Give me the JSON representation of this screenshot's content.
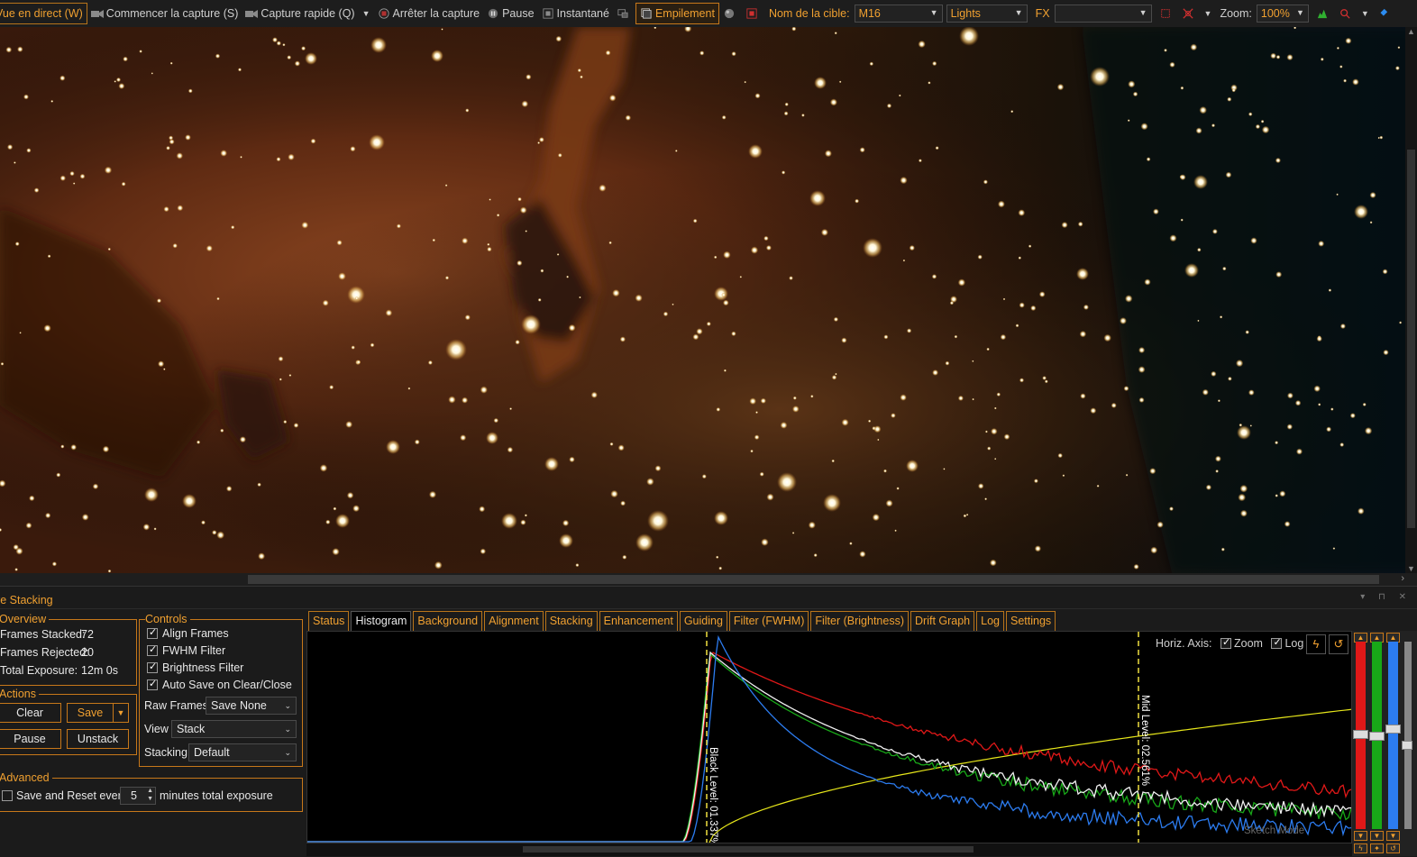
{
  "toolbar": {
    "live_view": "Vue en direct (W)",
    "start_capture": "Commencer la capture (S)",
    "quick_capture": "Capture rapide (Q)",
    "stop_capture": "Arrêter la capture",
    "pause": "Pause",
    "snapshot": "Instantané",
    "stacking": "Empilement",
    "target_label": "Nom de la cible:",
    "target_value": "M16",
    "frame_type": "Lights",
    "fx_label": "FX",
    "fx_value": "",
    "zoom_label": "Zoom:",
    "zoom_value": "100%"
  },
  "panel": {
    "title": "ve Stacking",
    "overview": {
      "title": "Overview",
      "frames_stacked_label": "Frames Stacked:",
      "frames_stacked_value": "72",
      "frames_rejected_label": "Frames Rejected:",
      "frames_rejected_value": "20",
      "total_exposure_label": "Total Exposure:",
      "total_exposure_value": "12m 0s"
    },
    "controls": {
      "title": "Controls",
      "align_frames": "Align Frames",
      "fwhm_filter": "FWHM Filter",
      "brightness_filter": "Brightness Filter",
      "auto_save": "Auto Save on Clear/Close",
      "raw_frames_label": "Raw Frames",
      "raw_frames_value": "Save None",
      "view_label": "View",
      "view_value": "Stack",
      "stacking_label": "Stacking",
      "stacking_value": "Default"
    },
    "actions": {
      "title": "Actions",
      "clear": "Clear",
      "save": "Save",
      "pause": "Pause",
      "unstack": "Unstack"
    },
    "advanced": {
      "title": "Advanced",
      "save_reset_label": "Save and Reset every",
      "save_reset_value": "5",
      "save_reset_suffix": "minutes total exposure"
    }
  },
  "tabs": [
    "Status",
    "Histogram",
    "Background",
    "Alignment",
    "Stacking",
    "Enhancement",
    "Guiding",
    "Filter (FWHM)",
    "Filter (Brightness)",
    "Drift Graph",
    "Log",
    "Settings"
  ],
  "histogram": {
    "horiz_axis_label": "Horiz. Axis:",
    "zoom_label": "Zoom",
    "log_label": "Log",
    "black_level": "Black Level: 01.337%",
    "mid_level": "Mid Level: 02.561%",
    "sketch_label": "Sketch Mode",
    "colors": {
      "red": "#e01818",
      "green": "#18a818",
      "blue": "#2c7cf0",
      "white": "#f0f0f0",
      "curve": "#e6e61a",
      "marker": "#f0e040"
    }
  },
  "image": {
    "target": "M16"
  }
}
